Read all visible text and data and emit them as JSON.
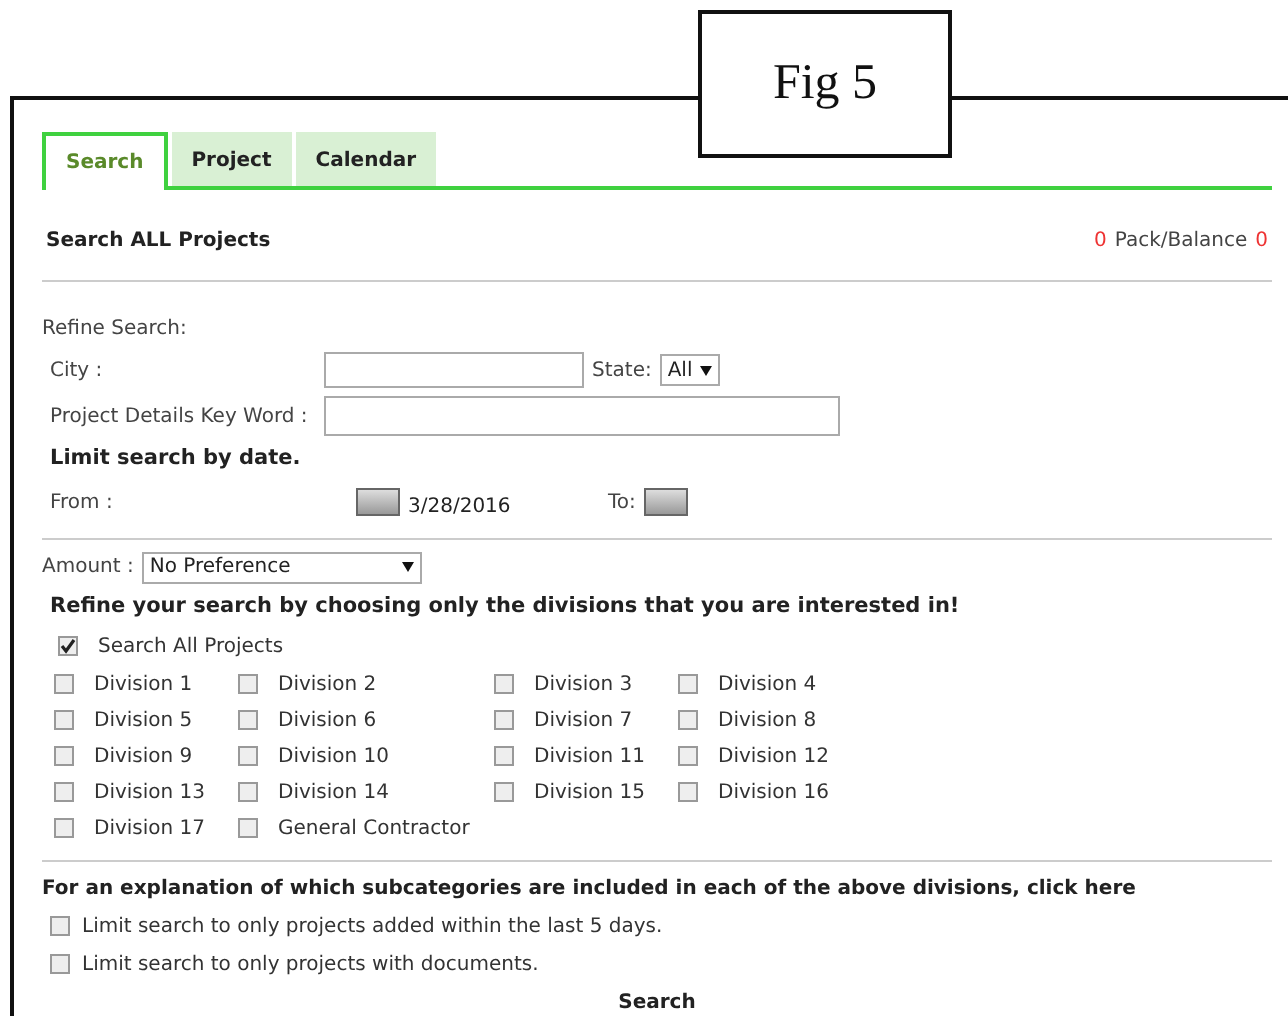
{
  "figure_label": "Fig 5",
  "tabs": [
    {
      "label": "Search",
      "selected": true
    },
    {
      "label": "Project",
      "selected": false
    },
    {
      "label": "Calendar",
      "selected": false
    }
  ],
  "header": {
    "title": "Search ALL Projects",
    "pack_count": "0",
    "pack_label": "Pack/Balance",
    "balance": "0"
  },
  "refine": {
    "heading": "Refine Search:",
    "city_label": "City :",
    "state_label": "State:",
    "state_value": "All",
    "keyword_label": "Project Details Key Word :",
    "date_heading": "Limit search by date.",
    "from_label": "From :",
    "from_date": "3/28/2016",
    "to_label": "To:"
  },
  "amount": {
    "label": "Amount :",
    "value": "No Preference"
  },
  "divisions_heading": "Refine your search by choosing only the divisions that you are interested in!",
  "search_all": {
    "label": "Search All Projects",
    "checked": true
  },
  "divisions": [
    {
      "label": "Division 1",
      "checked": false
    },
    {
      "label": "Division 2",
      "checked": false
    },
    {
      "label": "Division 3",
      "checked": false
    },
    {
      "label": "Division 4",
      "checked": false
    },
    {
      "label": "Division 5",
      "checked": false
    },
    {
      "label": "Division 6",
      "checked": false
    },
    {
      "label": "Division 7",
      "checked": false
    },
    {
      "label": "Division 8",
      "checked": false
    },
    {
      "label": "Division 9",
      "checked": false
    },
    {
      "label": "Division 10",
      "checked": false
    },
    {
      "label": "Division 11",
      "checked": false
    },
    {
      "label": "Division 12",
      "checked": false
    },
    {
      "label": "Division 13",
      "checked": false
    },
    {
      "label": "Division 14",
      "checked": false
    },
    {
      "label": "Division 15",
      "checked": false
    },
    {
      "label": "Division 16",
      "checked": false
    },
    {
      "label": "Division 17",
      "checked": false
    },
    {
      "label": "General Contractor",
      "checked": false
    }
  ],
  "explanation": {
    "text": "For an explanation of which subcategories are included in each of the above divisions,",
    "link": "click here"
  },
  "limits": [
    {
      "label": "Limit search to only projects added within the last 5 days.",
      "checked": false
    },
    {
      "label": "Limit search to only projects with documents.",
      "checked": false
    }
  ],
  "search_button": "Search"
}
